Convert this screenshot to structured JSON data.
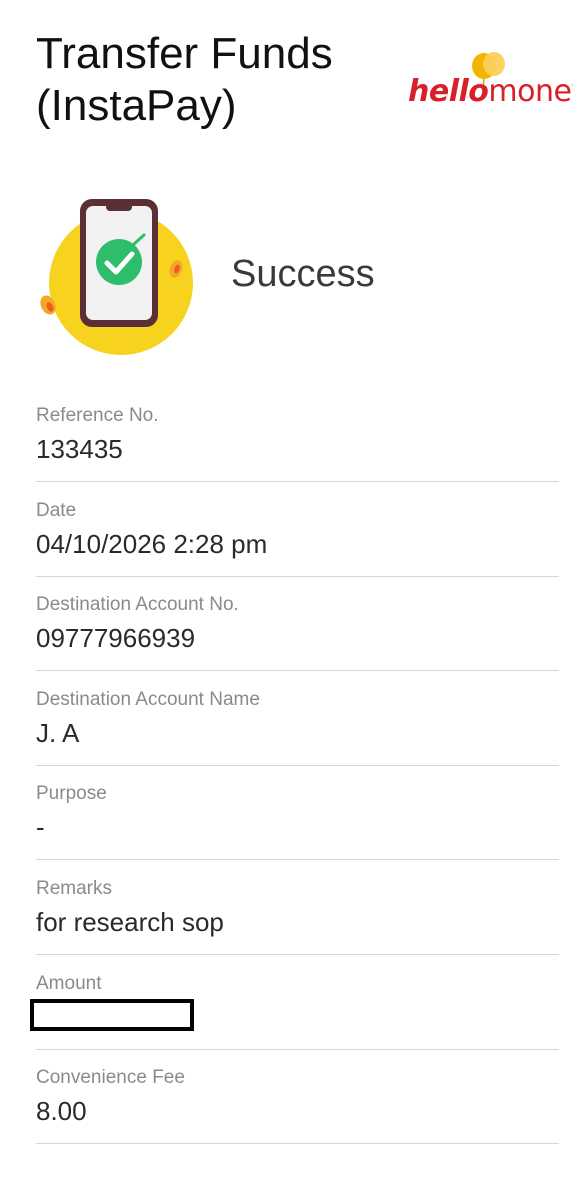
{
  "header": {
    "title_line1": "Transfer Funds",
    "title_line2": "(InstaPay)",
    "logo": {
      "part1": "hello",
      "part2": "money",
      "color": "#d8202a"
    }
  },
  "status": {
    "label": "Success",
    "icon": "phone-check-icon"
  },
  "fields": [
    {
      "label": "Reference No.",
      "value": "133435"
    },
    {
      "label": "Date",
      "value": "04/10/2026 2:28 pm"
    },
    {
      "label": "Destination Account No.",
      "value": "09777966939"
    },
    {
      "label": "Destination Account Name",
      "value": "J. A"
    },
    {
      "label": "Purpose",
      "value": "-"
    },
    {
      "label": "Remarks",
      "value": "for research sop"
    },
    {
      "label": "Amount",
      "value": ""
    },
    {
      "label": "Convenience Fee",
      "value": "8.00"
    }
  ],
  "colors": {
    "accent_yellow": "#f7d21f",
    "check_green": "#2ebd6b",
    "brand_red": "#d8202a"
  }
}
